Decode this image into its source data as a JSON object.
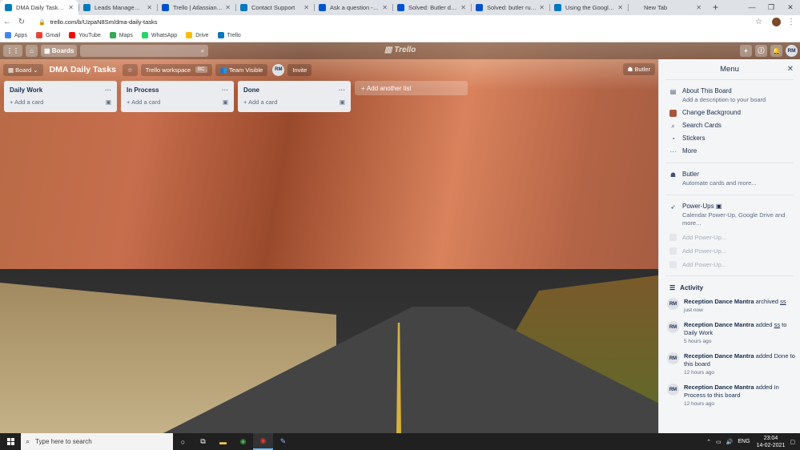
{
  "browser": {
    "tabs": [
      {
        "title": "DMA Daily Tasks | Trello",
        "active": true,
        "favicon_color": "#0079bf"
      },
      {
        "title": "Leads Management | T",
        "active": false,
        "favicon_color": "#0079bf"
      },
      {
        "title": "Trello | Atlassian Comm",
        "active": false,
        "favicon_color": "#0052cc"
      },
      {
        "title": "Contact Support",
        "active": false,
        "favicon_color": "#0079bf"
      },
      {
        "title": "Ask a question - Atlass",
        "active": false,
        "favicon_color": "#0052cc"
      },
      {
        "title": "Solved: Butler due date",
        "active": false,
        "favicon_color": "#0052cc"
      },
      {
        "title": "Solved: butler rule mov",
        "active": false,
        "favicon_color": "#0052cc"
      },
      {
        "title": "Using the Google Drive",
        "active": false,
        "favicon_color": "#0079bf"
      },
      {
        "title": "New Tab",
        "active": false,
        "favicon_color": "#dee1e6"
      }
    ],
    "url": "trello.com/b/UzpaN8Sm/dma-daily-tasks",
    "bookmarks": [
      {
        "label": "Apps",
        "icon_color": "#4285f4"
      },
      {
        "label": "Gmail",
        "icon_color": "#ea4335"
      },
      {
        "label": "YouTube",
        "icon_color": "#ff0000"
      },
      {
        "label": "Maps",
        "icon_color": "#34a853"
      },
      {
        "label": "WhatsApp",
        "icon_color": "#25d366"
      },
      {
        "label": "Drive",
        "icon_color": "#fbbc04"
      },
      {
        "label": "Trello",
        "icon_color": "#0079bf"
      }
    ]
  },
  "trello_header": {
    "boards_label": "Boards",
    "logo_text": "Trello",
    "user_initials": "RM"
  },
  "board": {
    "menu_label": "Board",
    "title": "DMA Daily Tasks",
    "workspace": "Trello workspace",
    "workspace_badge": "BC",
    "visibility": "Team Visible",
    "member_initials": "RM",
    "invite_label": "Invite",
    "butler_label": "Butler"
  },
  "lists": [
    {
      "name": "Daily Work",
      "add_card": "Add a card"
    },
    {
      "name": "In Process",
      "add_card": "Add a card"
    },
    {
      "name": "Done",
      "add_card": "Add a card"
    }
  ],
  "add_list_label": "Add another list",
  "menu": {
    "title": "Menu",
    "about_title": "About This Board",
    "about_sub": "Add a description to your board",
    "change_bg": "Change Background",
    "search_cards": "Search Cards",
    "stickers": "Stickers",
    "more": "More",
    "butler_title": "Butler",
    "butler_sub": "Automate cards and more...",
    "powerups_title": "Power-Ups",
    "powerups_sub": "Calendar Power-Up, Google Drive and more...",
    "add_powerup": "Add Power-Up...",
    "activity_title": "Activity",
    "activity": [
      {
        "who": "Reception Dance Mantra",
        "action": "archived",
        "target": "ss",
        "rest": "",
        "time": "just now"
      },
      {
        "who": "Reception Dance Mantra",
        "action": "added",
        "target": "ss",
        "rest": "to Daily Work",
        "time": "5 hours ago"
      },
      {
        "who": "Reception Dance Mantra",
        "action": "added Done to this board",
        "target": "",
        "rest": "",
        "time": "12 hours ago"
      },
      {
        "who": "Reception Dance Mantra",
        "action": "added In Process to this board",
        "target": "",
        "rest": "",
        "time": "12 hours ago"
      }
    ]
  },
  "taskbar": {
    "search_placeholder": "Type here to search",
    "language": "ENG",
    "time": "23:04",
    "date": "14-02-2021"
  }
}
